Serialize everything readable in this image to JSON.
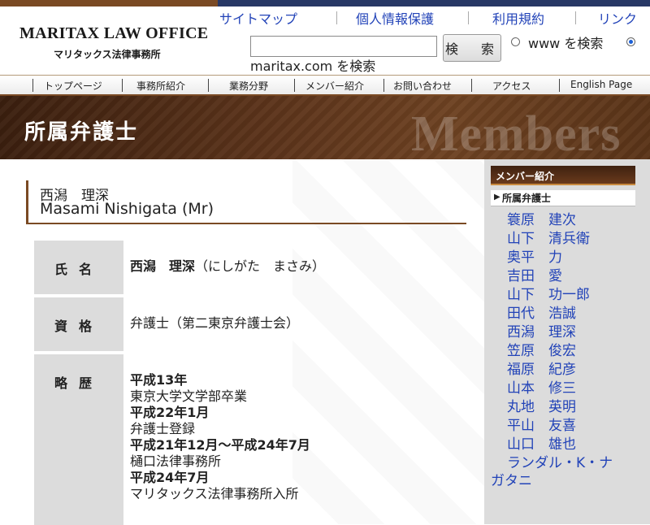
{
  "header": {
    "logo_en": "MARITAX LAW OFFICE",
    "logo_jp": "マリタックス法律事務所",
    "links": [
      "サイトマップ",
      "個人情報保護",
      "利用規約",
      "リンク"
    ],
    "search_button": "検　索",
    "radio_www": "www を検索",
    "radio_site": "maritax.com を検索",
    "selected_radio": "maritax.com"
  },
  "nav": [
    "トップページ",
    "事務所紹介",
    "業務分野",
    "メンバー紹介",
    "お問い合わせ",
    "アクセス",
    "English Page"
  ],
  "banner": {
    "title": "所属弁護士",
    "watermark": "Members"
  },
  "profile": {
    "name_jp": "西潟　理深",
    "name_en": "Masami Nishigata (Mr)",
    "rows": [
      {
        "label": "氏名",
        "value_name": "西潟　理深",
        "value_reading": "（にしがた　まさみ）"
      },
      {
        "label": "資格",
        "value": "弁護士（第二東京弁護士会）"
      },
      {
        "label": "略歴",
        "history": [
          {
            "text": "平成13年",
            "bold": true
          },
          {
            "text": "東京大学文学部卒業",
            "bold": false
          },
          {
            "text": "平成22年1月",
            "bold": true
          },
          {
            "text": "弁護士登録",
            "bold": false
          },
          {
            "text": "平成21年12月～平成24年7月",
            "bold": true
          },
          {
            "text": "樋口法律事務所",
            "bold": false
          },
          {
            "text": "平成24年7月",
            "bold": true
          },
          {
            "text": "マリタックス法律事務所入所",
            "bold": false
          }
        ]
      }
    ]
  },
  "sidebar": {
    "heading": "メンバー紹介",
    "subheading": "所属弁護士",
    "members": [
      "簑原　建次",
      "山下　清兵衛",
      "奥平　力",
      "吉田　愛",
      "山下　功一郎",
      "田代　浩誠",
      "西潟　理深",
      "笠原　俊宏",
      "福原　紀彦",
      "山本　修三",
      "丸地　英明",
      "平山　友喜",
      "山口　雄也",
      "ランダル・K・ナ",
      "ガタニ"
    ]
  },
  "colors": {
    "brown": "#7a4a24",
    "navy": "#283865",
    "link": "#2243b8",
    "sidebar_bg": "#dcdcdc"
  }
}
